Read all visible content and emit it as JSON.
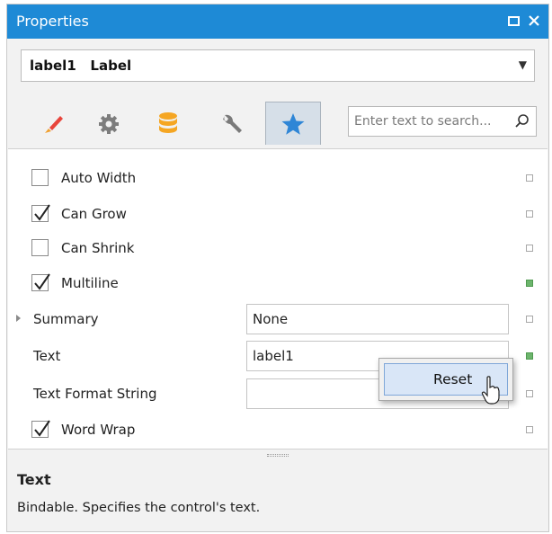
{
  "window": {
    "title": "Properties",
    "restore_icon": "maximize-icon",
    "close_icon": "close-icon",
    "titlebar_color": "#1e8ad6"
  },
  "object_selector": {
    "value": "label1   Label"
  },
  "tabs": [
    {
      "icon": "brush-icon",
      "active": false
    },
    {
      "icon": "gear-icon",
      "active": false
    },
    {
      "icon": "database-icon",
      "active": false
    },
    {
      "icon": "wrench-icon",
      "active": false
    },
    {
      "icon": "star-icon",
      "active": true
    }
  ],
  "search": {
    "placeholder": "Enter text to search..."
  },
  "properties": [
    {
      "label": "Auto Width",
      "kind": "checkbox",
      "checked": false,
      "modified": false
    },
    {
      "label": "Can Grow",
      "kind": "checkbox",
      "checked": true,
      "modified": false
    },
    {
      "label": "Can Shrink",
      "kind": "checkbox",
      "checked": false,
      "modified": false
    },
    {
      "label": "Multiline",
      "kind": "checkbox",
      "checked": true,
      "modified": true
    },
    {
      "label": "Summary",
      "kind": "text",
      "value": "None",
      "expandable": true,
      "modified": false
    },
    {
      "label": "Text",
      "kind": "text",
      "value": "label1",
      "modified": true
    },
    {
      "label": "Text Format String",
      "kind": "text",
      "value": "",
      "modified": false
    },
    {
      "label": "Word Wrap",
      "kind": "checkbox",
      "checked": true,
      "modified": false
    }
  ],
  "context_menu": {
    "items": [
      "Reset"
    ]
  },
  "description": {
    "title": "Text",
    "text": "Bindable. Specifies the control's text."
  }
}
